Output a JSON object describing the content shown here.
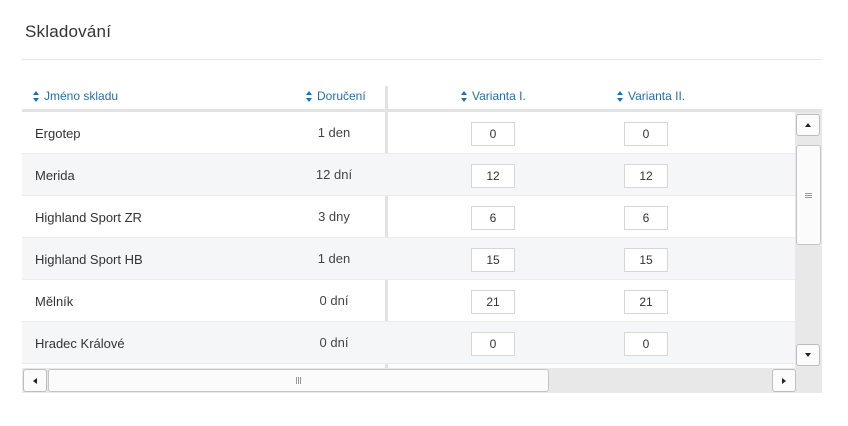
{
  "section_title": "Skladování",
  "columns": {
    "name": "Jméno skladu",
    "delivery": "Doručení",
    "variant1": "Varianta I.",
    "variant2": "Varianta II."
  },
  "rows": [
    {
      "name": "Ergotep",
      "delivery": "1 den",
      "v1": "0",
      "v2": "0"
    },
    {
      "name": "Merida",
      "delivery": "12 dní",
      "v1": "12",
      "v2": "12"
    },
    {
      "name": "Highland Sport ZR",
      "delivery": "3 dny",
      "v1": "6",
      "v2": "6"
    },
    {
      "name": "Highland Sport HB",
      "delivery": "1 den",
      "v1": "15",
      "v2": "15"
    },
    {
      "name": "Mělník",
      "delivery": "0 dní",
      "v1": "21",
      "v2": "21"
    },
    {
      "name": "Hradec Králové",
      "delivery": "0 dní",
      "v1": "0",
      "v2": "0"
    }
  ],
  "colors": {
    "header_link": "#1f6fb2",
    "alt_row": "#f5f6f8",
    "scrollbar_track": "#e8e8e8"
  },
  "icons": {
    "sort": "sort-icon",
    "scroll_up": "chevron-up-icon",
    "scroll_down": "chevron-down-icon",
    "scroll_left": "chevron-left-icon",
    "scroll_right": "chevron-right-icon"
  }
}
